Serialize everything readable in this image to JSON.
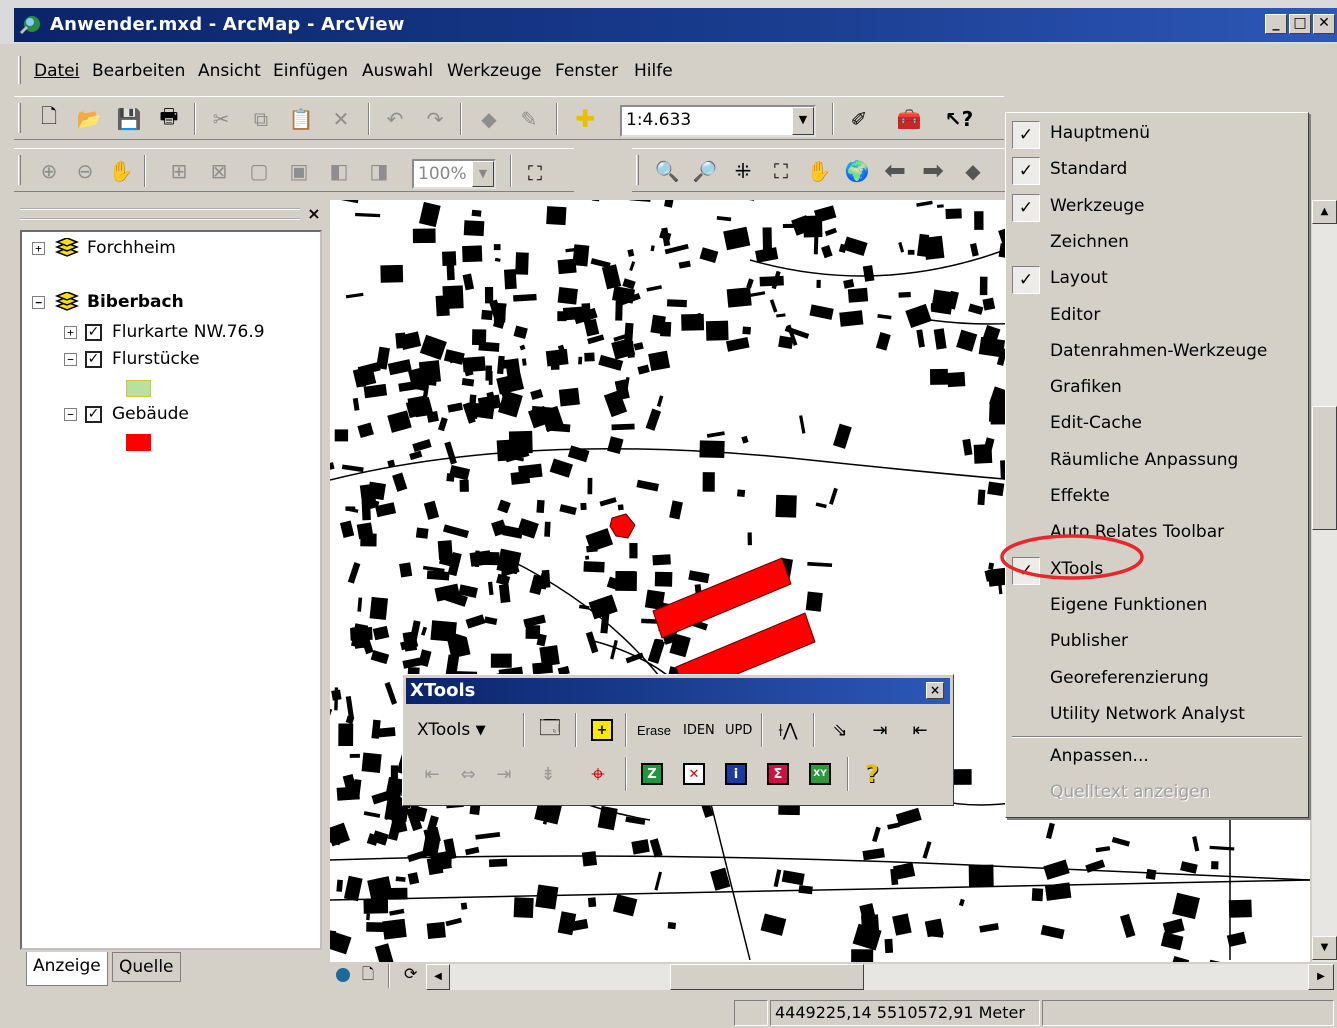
{
  "window": {
    "title": "Anwender.mxd - ArcMap - ArcView",
    "controls": {
      "minimize": "_",
      "maximize": "□",
      "close": "✕"
    }
  },
  "menubar": {
    "items": [
      {
        "label": "Datei",
        "accel": "D"
      },
      {
        "label": "Bearbeiten",
        "accel": "B"
      },
      {
        "label": "Ansicht",
        "accel": "A"
      },
      {
        "label": "Einfügen",
        "accel": "E"
      },
      {
        "label": "Auswahl",
        "accel": "u"
      },
      {
        "label": "Werkzeuge",
        "accel": "W"
      },
      {
        "label": "Fenster",
        "accel": "F"
      },
      {
        "label": "Hilfe",
        "accel": "H"
      }
    ]
  },
  "standard_toolbar": {
    "scale_value": "1:4.633",
    "icons": [
      "new-icon",
      "open-icon",
      "save-icon",
      "print-icon",
      "cut-icon",
      "copy-icon",
      "paste-icon",
      "delete-icon",
      "undo-icon",
      "redo-icon",
      "pen-icon",
      "pen-tool-icon",
      "add-data-icon",
      "editor-icon",
      "arc-toolbox-icon",
      "whats-this-icon"
    ]
  },
  "layout_toolbar": {
    "zoom_value": "100%",
    "icons": [
      "zoom-in-page-icon",
      "zoom-out-page-icon",
      "pan-page-icon",
      "zoom-whole-page-icon",
      "zoom-fixed-icon",
      "zoom-100-icon",
      "fit-icon",
      "back-extent-icon",
      "forward-extent-icon",
      "focus-data-frame-icon"
    ]
  },
  "tools_toolbar": {
    "icons": [
      "zoom-in-icon",
      "zoom-out-icon",
      "fixed-zoom-in-icon",
      "fixed-zoom-out-icon",
      "pan-hand-icon",
      "full-extent-icon",
      "back-arrow-icon",
      "forward-arrow-icon"
    ]
  },
  "toc": {
    "groups": [
      {
        "name": "Forchheim",
        "expanded": false,
        "bold": false
      },
      {
        "name": "Biberbach",
        "expanded": true,
        "bold": true,
        "layers": [
          {
            "name": "Flurkarte NW.76.9",
            "checked": true,
            "expanded": false
          },
          {
            "name": "Flurstücke",
            "checked": true,
            "expanded": true,
            "swatch": "#b8e0a0"
          },
          {
            "name": "Gebäude",
            "checked": true,
            "expanded": true,
            "swatch": "#ff0000"
          }
        ]
      }
    ],
    "tabs": [
      "Anzeige",
      "Quelle"
    ],
    "close": "×"
  },
  "context_menu": {
    "items": [
      {
        "label": "Hauptmenü",
        "checked": true,
        "disabled": false
      },
      {
        "label": "Standard",
        "checked": true,
        "disabled": false
      },
      {
        "label": "Werkzeuge",
        "checked": true,
        "disabled": false
      },
      {
        "label": "Zeichnen",
        "checked": false,
        "disabled": false
      },
      {
        "label": "Layout",
        "checked": true,
        "disabled": false
      },
      {
        "label": "Editor",
        "checked": false,
        "disabled": false
      },
      {
        "label": "Datenrahmen-Werkzeuge",
        "checked": false,
        "disabled": false
      },
      {
        "label": "Grafiken",
        "checked": false,
        "disabled": false
      },
      {
        "label": "Edit-Cache",
        "checked": false,
        "disabled": false
      },
      {
        "label": "Räumliche Anpassung",
        "checked": false,
        "disabled": false
      },
      {
        "label": "Effekte",
        "checked": false,
        "disabled": false
      },
      {
        "label": "Auto Relates Toolbar",
        "checked": false,
        "disabled": false
      },
      {
        "label": "XTools",
        "checked": true,
        "disabled": false,
        "highlighted": true
      },
      {
        "label": "Eigene Funktionen",
        "checked": false,
        "disabled": false
      },
      {
        "label": "Publisher",
        "checked": false,
        "disabled": false
      },
      {
        "label": "Georeferenzierung",
        "checked": false,
        "disabled": false
      },
      {
        "label": "Utility Network Analyst",
        "checked": false,
        "disabled": false
      },
      {
        "label": "Anpassen...",
        "checked": false,
        "disabled": false,
        "separator_before": true
      },
      {
        "label": "Quelltext anzeigen",
        "checked": false,
        "disabled": true
      }
    ],
    "check_glyph": "✓",
    "highlight_color": "#e8262b"
  },
  "xtools_toolbar": {
    "title": "XTools",
    "close": "×",
    "dropdown_label": "XTools",
    "dropdown_arrow": "▼",
    "row1_text_buttons": [
      "Erase",
      "IDEN",
      "UPD"
    ],
    "help_glyph": "?",
    "sum_glyph": "Σ",
    "xy_label": "XY",
    "z_label": "Z",
    "i_label": "i"
  },
  "map": {
    "building_red": "#ff0000",
    "building_black": "#000000",
    "background": "#ffffff"
  },
  "statusbar": {
    "coordinates": "4449225,14  5510572,91 Meter"
  },
  "glyphs": {
    "plus": "+",
    "minus": "−",
    "check": "✓",
    "arrow_left": "◀",
    "arrow_right": "▶",
    "arrow_up": "▲",
    "arrow_down": "▼",
    "dropdown": "▼"
  }
}
